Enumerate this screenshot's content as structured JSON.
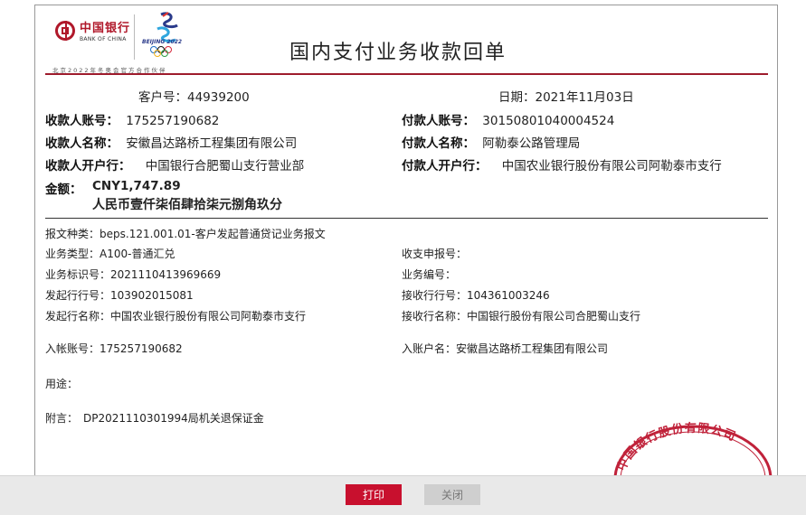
{
  "header": {
    "bank_name_cn": "中国银行",
    "bank_name_en": "BANK OF CHINA",
    "olympic_text": "BEIJING 2022",
    "partner_line": "北京2022年冬奥会官方合作伙伴",
    "title": "国内支付业务收款回单"
  },
  "summary": {
    "customer_no_label": "客户号：",
    "customer_no": "44939200",
    "date_label": "日期：",
    "date": "2021年11月03日",
    "payee_account_label": "收款人账号：",
    "payee_account": "175257190682",
    "payer_account_label": "付款人账号：",
    "payer_account": "30150801040004524",
    "payee_name_label": "收款人名称：",
    "payee_name": "安徽昌达路桥工程集团有限公司",
    "payer_name_label": "付款人名称：",
    "payer_name": "阿勒泰公路管理局",
    "payee_bank_label": "收款人开户行：",
    "payee_bank": "中国银行合肥蜀山支行营业部",
    "payer_bank_label": "付款人开户行：",
    "payer_bank": "中国农业银行股份有限公司阿勒泰市支行",
    "amount_label": "金额：",
    "amount": "CNY1,747.89",
    "amount_words": "人民币壹仟柒佰肆拾柒元捌角玖分"
  },
  "details": {
    "msg_type_label": "报文种类：",
    "msg_type": "beps.121.001.01-客户发起普通贷记业务报文",
    "biz_type_label": "业务类型：",
    "biz_type": "A100-普通汇兑",
    "declare_no_label": "收支申报号：",
    "declare_no": "",
    "biz_id_label": "业务标识号：",
    "biz_id": "2021110413969669",
    "biz_no_label": "业务编号：",
    "biz_no": "",
    "send_bank_no_label": "发起行行号：",
    "send_bank_no": "103902015081",
    "recv_bank_no_label": "接收行行号：",
    "recv_bank_no": "104361003246",
    "send_bank_name_label": "发起行名称：",
    "send_bank_name": "中国农业银行股份有限公司阿勒泰市支行",
    "recv_bank_name_label": "接收行名称：",
    "recv_bank_name": "中国银行股份有限公司合肥蜀山支行",
    "in_account_label": "入帐账号：",
    "in_account": "175257190682",
    "in_account_name_label": "入账户名：",
    "in_account_name": "安徽昌达路桥工程集团有限公司",
    "purpose_label": "用途：",
    "purpose": "",
    "remark_label": "附言：",
    "remark": "DP2021110301994局机关退保证金"
  },
  "stamp": {
    "text": "中国银行股份有限公司",
    "color": "#c0223a"
  },
  "toolbar": {
    "print_label": "打印",
    "close_label": "关闭"
  },
  "colors": {
    "brand_red": "#b0182a",
    "rule_red": "#9e1b2c",
    "print_button": "#c8102e"
  }
}
